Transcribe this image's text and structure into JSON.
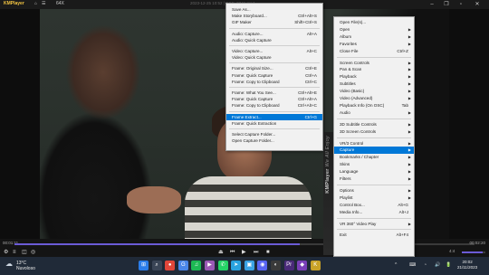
{
  "titlebar": {
    "app_name": "KMPlayer",
    "app_suffix": "64X",
    "center_text": "2023-12-25 10:52 | DSC_0341.mp4",
    "buttons": [
      "⌂",
      "☰",
      "▾"
    ]
  },
  "player": {
    "time_current": "00:01:11",
    "time_total": "00:02:20",
    "progress": 0.62,
    "volume": 0.9,
    "volume_label": "4:4"
  },
  "controls": {
    "play": "▶",
    "stop": "■",
    "prev": "⏮",
    "next": "⏭",
    "eject": "⏏"
  },
  "taskbar": {
    "temperature": "13°C",
    "weather_desc": "Nuvoloso",
    "time": "20:02",
    "date": "21/11/2023",
    "icons": [
      {
        "name": "windows-start-icon",
        "glyph": "⊞",
        "color": "#2b7de9"
      },
      {
        "name": "search-icon",
        "glyph": "⌕",
        "color": "#3a4556"
      },
      {
        "name": "chrome-icon",
        "glyph": "●",
        "color": "#e0463a"
      },
      {
        "name": "google-icon",
        "glyph": "G",
        "color": "#4a86e8"
      },
      {
        "name": "spotify-icon",
        "glyph": "♫",
        "color": "#1db954"
      },
      {
        "name": "clipchamp-icon",
        "glyph": "▶",
        "color": "#9b59b6"
      },
      {
        "name": "whatsapp-icon",
        "glyph": "✆",
        "color": "#25d366"
      },
      {
        "name": "telegram-icon",
        "glyph": "➤",
        "color": "#2aa3e0"
      },
      {
        "name": "photos-icon",
        "glyph": "▣",
        "color": "#3ba3e5"
      },
      {
        "name": "discord-icon",
        "glyph": "◉",
        "color": "#5865f2"
      },
      {
        "name": "obs-icon",
        "glyph": "◐",
        "color": "#3a3a3a"
      },
      {
        "name": "premiere-icon",
        "glyph": "Pr",
        "color": "#4a2a7a"
      },
      {
        "name": "visual-studio-icon",
        "glyph": "◆",
        "color": "#7a3fb8"
      },
      {
        "name": "kmplayer-icon",
        "glyph": "K",
        "color": "#c9a227"
      }
    ],
    "tray": [
      "^",
      "⌨",
      "◔",
      "🔊",
      "🔋"
    ]
  },
  "main_menu": {
    "items": [
      {
        "label": "Open File(s)...",
        "shortcut": "",
        "arrow": false
      },
      {
        "label": "Open",
        "shortcut": "",
        "arrow": true
      },
      {
        "label": "Album",
        "shortcut": "",
        "arrow": true
      },
      {
        "label": "Favorites",
        "shortcut": "",
        "arrow": true
      },
      {
        "label": "Close File",
        "shortcut": "Ctrl+Z",
        "arrow": false
      },
      {
        "sep": true
      },
      {
        "label": "Screen Controls",
        "shortcut": "",
        "arrow": true
      },
      {
        "label": "Pan & Scan",
        "shortcut": "",
        "arrow": true
      },
      {
        "label": "Playback",
        "shortcut": "",
        "arrow": true
      },
      {
        "label": "Subtitles",
        "shortcut": "",
        "arrow": true
      },
      {
        "label": "Video (Basic)",
        "shortcut": "",
        "arrow": true
      },
      {
        "label": "Video (Advanced)",
        "shortcut": "",
        "arrow": true
      },
      {
        "label": "Playback Info (On OSC)",
        "shortcut": "Tab",
        "arrow": false
      },
      {
        "label": "Audio",
        "shortcut": "",
        "arrow": true
      },
      {
        "sep": true
      },
      {
        "label": "3D Subtitle Controls",
        "shortcut": "",
        "arrow": true
      },
      {
        "label": "3D Screen Controls",
        "shortcut": "",
        "arrow": true
      },
      {
        "sep": true
      },
      {
        "label": "VR/3 Control",
        "shortcut": "",
        "arrow": true
      },
      {
        "label": "Capture",
        "shortcut": "",
        "arrow": true,
        "highlight": true
      },
      {
        "label": "Bookmarks / Chapter",
        "shortcut": "",
        "arrow": true
      },
      {
        "label": "Skins",
        "shortcut": "",
        "arrow": true
      },
      {
        "label": "Language",
        "shortcut": "",
        "arrow": true
      },
      {
        "label": "Filters",
        "shortcut": "",
        "arrow": true
      },
      {
        "sep": true
      },
      {
        "label": "Options",
        "shortcut": "",
        "arrow": true
      },
      {
        "label": "Playlist",
        "shortcut": "",
        "arrow": true
      },
      {
        "label": "Control Box...",
        "shortcut": "Alt+G",
        "arrow": false
      },
      {
        "label": "Media Info...",
        "shortcut": "Alt+J",
        "arrow": false
      },
      {
        "sep": true
      },
      {
        "label": "VR 360° Video Play",
        "shortcut": "",
        "arrow": true
      },
      {
        "sep": true
      },
      {
        "label": "Exit",
        "shortcut": "Alt+F4",
        "arrow": false
      }
    ],
    "side_band": "KMPlayer",
    "side_band_sub": "We All Enjoy"
  },
  "capture_menu": {
    "items": [
      {
        "label": "Save As...",
        "shortcut": ""
      },
      {
        "label": "Make Storyboard...",
        "shortcut": "Ctrl+Alt+S"
      },
      {
        "label": "GIF Maker",
        "shortcut": "Shift+Ctrl+S"
      },
      {
        "sep": true
      },
      {
        "label": "Audio: Capture...",
        "shortcut": "Alt+A"
      },
      {
        "label": "Audio: Quick Capture",
        "shortcut": ""
      },
      {
        "sep": true
      },
      {
        "label": "Video: Capture...",
        "shortcut": "Alt+C"
      },
      {
        "label": "Video: Quick Capture",
        "shortcut": ""
      },
      {
        "sep": true
      },
      {
        "label": "Frame: Original Size...",
        "shortcut": "Ctrl+E"
      },
      {
        "label": "Frame: Quick Capture",
        "shortcut": "Ctrl+A"
      },
      {
        "label": "Frame: Copy to Clipboard",
        "shortcut": "Ctrl+C"
      },
      {
        "sep": true
      },
      {
        "label": "Frame: What You See...",
        "shortcut": "Ctrl+Alt+E"
      },
      {
        "label": "Frame: Quick Capture",
        "shortcut": "Ctrl+Alt+A"
      },
      {
        "label": "Frame: Copy to Clipboard",
        "shortcut": "Ctrl+Alt+C"
      },
      {
        "sep": true
      },
      {
        "label": "Frame Extract...",
        "shortcut": "Ctrl+G",
        "highlight": true
      },
      {
        "label": "Frame: Quick Extraction",
        "shortcut": ""
      },
      {
        "sep": true
      },
      {
        "label": "Select Capture Folder...",
        "shortcut": ""
      },
      {
        "label": "Open Capture Folder...",
        "shortcut": ""
      }
    ]
  }
}
